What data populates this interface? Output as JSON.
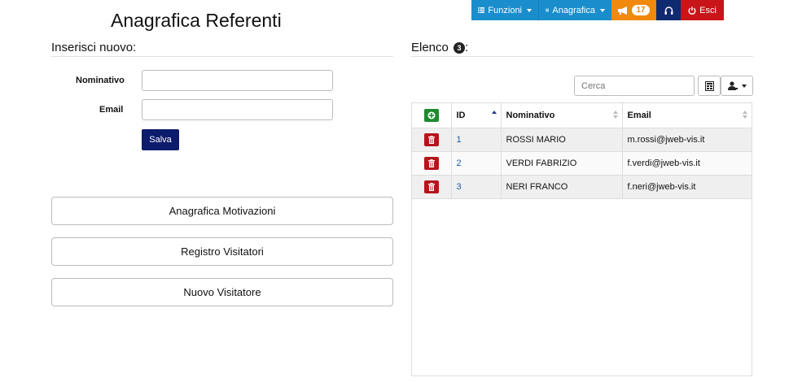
{
  "nav": {
    "funzioni": "Funzioni",
    "anagrafica": "Anagrafica",
    "notif_count": "17",
    "esci": "Esci"
  },
  "page_title": "Anagrafica Referenti",
  "form": {
    "heading": "Inserisci nuovo:",
    "nominativo_label": "Nominativo",
    "nominativo_value": "",
    "email_label": "Email",
    "email_value": "",
    "save_label": "Salva"
  },
  "links": {
    "motivazioni": "Anagrafica Motivazioni",
    "registro": "Registro Visitatori",
    "nuovo": "Nuovo Visitatore"
  },
  "list": {
    "heading": "Elenco",
    "count": "3",
    "heading_suffix": ":",
    "search_placeholder": "Cerca",
    "columns": [
      "ID",
      "Nominativo",
      "Email"
    ],
    "rows": [
      {
        "id": "1",
        "nominativo": "ROSSI MARIO",
        "email": "m.rossi@jweb-vis.it"
      },
      {
        "id": "2",
        "nominativo": "VERDI FABRIZIO",
        "email": "f.verdi@jweb-vis.it"
      },
      {
        "id": "3",
        "nominativo": "NERI FRANCO",
        "email": "f.neri@jweb-vis.it"
      }
    ]
  },
  "colors": {
    "nav_blue": "#1a8ecc",
    "nav_orange": "#f0890c",
    "nav_navy": "#0f2a6e",
    "nav_red": "#c9141a",
    "save_button": "#0c1b6b",
    "add_green": "#1f8a2f",
    "delete_red": "#b5151b"
  }
}
